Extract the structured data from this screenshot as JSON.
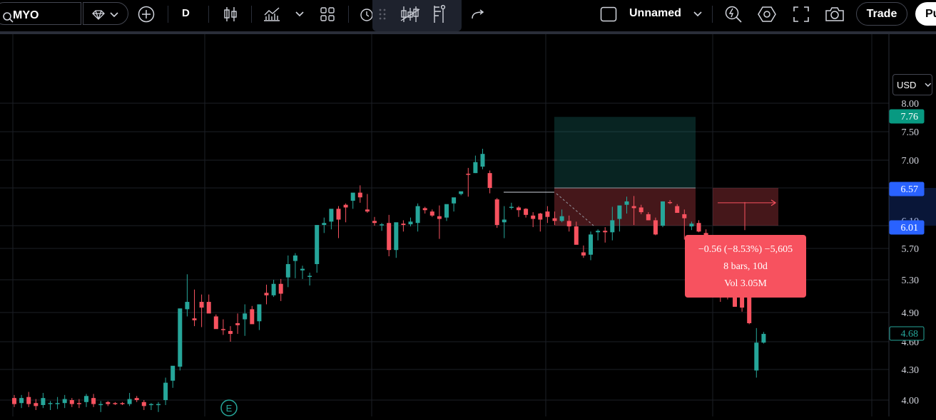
{
  "toolbar": {
    "symbol": "MYO",
    "interval": "D",
    "layout_name": "Unnamed",
    "trade_label": "Trade",
    "publish_label": "Pu"
  },
  "price_scale": {
    "currency": "USD",
    "tick_labels": [
      "8.00",
      "7.50",
      "7.00",
      "6.10",
      "5.70",
      "5.30",
      "4.90",
      "4.60",
      "4.30",
      "4.00"
    ],
    "badges": {
      "target": "7.76",
      "entry": "6.57",
      "stop": "6.01",
      "last": "4.68"
    }
  },
  "measure_tooltip": {
    "line1": "−0.56 (−8.53%) −5,605",
    "line2": "8 bars, 10d",
    "line3": "Vol 3.05M"
  },
  "colors": {
    "up": "#26a69a",
    "down": "#f7525f",
    "accent": "#2962ff",
    "background": "#000000"
  },
  "earnings_marker": "E",
  "icons": [
    "search-icon",
    "diamond-icon",
    "chevron-down-icon",
    "plus-circle-icon",
    "candles-icon",
    "indicators-icon",
    "templates-icon",
    "alert-icon",
    "drag-handle-icon",
    "long-position-icon",
    "fib-icon",
    "redo-icon",
    "square-icon",
    "replay-icon",
    "settings-icon",
    "fullscreen-icon",
    "camera-icon"
  ],
  "chart_data": {
    "type": "candlestick",
    "candles_ohlc": [
      [
        4.02,
        4.05,
        3.93,
        3.96
      ],
      [
        3.97,
        4.05,
        3.92,
        4.02
      ],
      [
        4.03,
        4.08,
        3.93,
        3.96
      ],
      [
        3.97,
        4.01,
        3.9,
        3.94
      ],
      [
        3.95,
        4.07,
        3.92,
        4.02
      ],
      [
        3.97,
        3.99,
        3.9,
        3.97
      ],
      [
        3.97,
        4.03,
        3.91,
        3.97
      ],
      [
        3.97,
        4.05,
        3.92,
        4.01
      ],
      [
        4.0,
        4.02,
        3.93,
        3.96
      ],
      [
        3.97,
        4.01,
        3.92,
        3.96
      ],
      [
        3.98,
        4.06,
        3.93,
        4.04
      ],
      [
        4.02,
        4.06,
        3.93,
        3.96
      ],
      [
        3.95,
        3.99,
        3.88,
        3.96
      ],
      [
        3.98,
        3.99,
        3.94,
        3.96
      ],
      [
        3.97,
        3.98,
        3.95,
        3.96
      ],
      [
        3.97,
        3.98,
        3.95,
        3.96
      ],
      [
        3.96,
        4.07,
        3.94,
        4.01
      ],
      [
        4.02,
        4.04,
        3.98,
        4.0
      ],
      [
        3.98,
        4.0,
        3.9,
        3.94
      ],
      [
        3.95,
        3.97,
        3.9,
        3.96
      ],
      [
        3.95,
        3.98,
        3.88,
        3.96
      ],
      [
        4.0,
        4.22,
        3.95,
        4.17
      ],
      [
        4.19,
        4.28,
        4.12,
        4.34
      ],
      [
        4.33,
        4.85,
        4.29,
        4.95
      ],
      [
        4.94,
        5.37,
        4.86,
        5.03
      ],
      [
        4.84,
        5.18,
        4.76,
        4.82
      ],
      [
        5.03,
        5.12,
        4.75,
        4.96
      ],
      [
        5.03,
        5.12,
        4.92,
        4.89
      ],
      [
        4.86,
        4.88,
        4.79,
        4.73
      ],
      [
        4.73,
        4.83,
        4.67,
        4.72
      ],
      [
        4.71,
        4.76,
        4.6,
        4.68
      ],
      [
        4.79,
        4.89,
        4.68,
        4.77
      ],
      [
        4.83,
        5.0,
        4.66,
        4.89
      ],
      [
        4.94,
        4.98,
        4.81,
        4.78
      ],
      [
        4.81,
        4.97,
        4.72,
        5.0
      ],
      [
        5.14,
        5.24,
        5.0,
        5.11
      ],
      [
        5.11,
        5.3,
        5.09,
        5.25
      ],
      [
        5.25,
        5.31,
        5.04,
        5.13
      ],
      [
        5.33,
        5.61,
        5.21,
        5.5
      ],
      [
        5.54,
        5.64,
        5.32,
        5.61
      ],
      [
        5.42,
        5.48,
        5.31,
        5.44
      ],
      [
        5.35,
        5.39,
        5.23,
        5.35
      ],
      [
        5.5,
        5.96,
        5.39,
        6.02
      ],
      [
        6.02,
        6.13,
        5.91,
        6.05
      ],
      [
        6.07,
        6.13,
        5.96,
        6.26
      ],
      [
        6.26,
        6.3,
        5.84,
        6.1
      ],
      [
        6.32,
        6.34,
        6.06,
        6.28
      ],
      [
        6.38,
        6.45,
        6.26,
        6.5
      ],
      [
        6.5,
        6.61,
        6.35,
        6.43
      ],
      [
        6.25,
        6.48,
        6.2,
        6.22
      ],
      [
        6.08,
        6.14,
        6.01,
        6.05
      ],
      [
        6.02,
        6.05,
        5.94,
        6.03
      ],
      [
        6.05,
        6.17,
        5.6,
        5.68
      ],
      [
        5.68,
        5.69,
        5.58,
        6.06
      ],
      [
        6.04,
        6.09,
        5.93,
        6.02
      ],
      [
        6.03,
        6.13,
        6.0,
        6.07
      ],
      [
        6.05,
        6.34,
        5.93,
        6.3
      ],
      [
        6.27,
        6.29,
        6.19,
        6.24
      ],
      [
        6.22,
        6.25,
        6.14,
        6.16
      ],
      [
        6.15,
        6.31,
        5.83,
        6.11
      ],
      [
        6.13,
        6.32,
        6.08,
        6.33
      ],
      [
        6.34,
        6.42,
        6.22,
        6.43
      ],
      [
        6.48,
        6.5,
        6.46,
        6.52
      ],
      [
        6.79,
        6.88,
        6.44,
        6.78
      ],
      [
        6.8,
        7.08,
        6.8,
        6.97
      ],
      [
        6.9,
        7.2,
        6.86,
        7.11
      ],
      [
        6.8,
        6.84,
        6.49,
        6.57
      ],
      [
        6.4,
        6.42,
        5.98,
        6.02
      ],
      [
        6.06,
        6.3,
        5.84,
        6.1
      ],
      [
        6.28,
        6.35,
        6.25,
        6.29
      ],
      [
        6.28,
        6.3,
        6.14,
        6.24
      ],
      [
        6.26,
        6.27,
        6.13,
        6.17
      ],
      [
        6.16,
        6.21,
        5.99,
        6.11
      ],
      [
        6.19,
        6.2,
        5.93,
        6.1
      ],
      [
        6.22,
        6.3,
        6.05,
        6.14
      ],
      [
        6.12,
        6.22,
        6.02,
        6.08
      ],
      [
        6.08,
        6.25,
        6.06,
        6.15
      ],
      [
        6.08,
        6.16,
        5.93,
        6.0
      ],
      [
        6.0,
        6.07,
        5.78,
        5.75
      ],
      [
        5.65,
        5.74,
        5.58,
        5.61
      ],
      [
        5.62,
        5.93,
        5.55,
        5.89
      ],
      [
        5.92,
        5.96,
        5.81,
        5.94
      ],
      [
        5.94,
        5.99,
        5.78,
        5.92
      ],
      [
        5.92,
        6.29,
        5.81,
        6.09
      ],
      [
        6.11,
        6.29,
        5.93,
        6.31
      ],
      [
        6.32,
        6.44,
        6.19,
        6.37
      ],
      [
        6.3,
        6.45,
        6.02,
        6.27
      ],
      [
        6.28,
        6.32,
        6.18,
        6.21
      ],
      [
        6.18,
        6.21,
        6.09,
        6.09
      ],
      [
        6.09,
        6.13,
        5.88,
        5.89
      ],
      [
        6.01,
        6.37,
        5.99,
        6.37
      ],
      [
        6.36,
        6.39,
        6.33,
        6.35
      ],
      [
        6.3,
        6.33,
        6.22,
        6.2
      ],
      [
        6.18,
        6.25,
        5.82,
        6.12
      ],
      [
        6.0,
        6.07,
        5.95,
        6.04
      ],
      [
        6.05,
        6.09,
        5.92,
        5.93
      ],
      [
        5.91,
        5.96,
        5.7,
        5.77
      ],
      [
        5.66,
        5.67,
        5.32,
        5.32
      ],
      [
        5.26,
        5.31,
        5.03,
        5.14
      ],
      [
        5.12,
        5.2,
        5.06,
        5.09
      ],
      [
        5.19,
        5.22,
        4.97,
        4.97
      ],
      [
        5.14,
        5.14,
        4.91,
        4.96
      ],
      [
        5.11,
        5.13,
        4.78,
        4.79
      ],
      [
        4.29,
        4.74,
        4.22,
        4.59
      ],
      [
        4.59,
        4.7,
        4.58,
        4.68
      ]
    ],
    "y_range": [
      3.95,
      8.3
    ],
    "y_ticks": [
      8.0,
      7.5,
      7.0,
      6.1,
      5.7,
      5.3,
      4.9,
      4.6,
      4.3,
      4.0
    ],
    "long_position": {
      "entry": 6.57,
      "target": 7.76,
      "stop": 6.01
    },
    "measure_range": {
      "from": 6.57,
      "to": 6.01
    },
    "currency": "USD",
    "grid": true
  }
}
